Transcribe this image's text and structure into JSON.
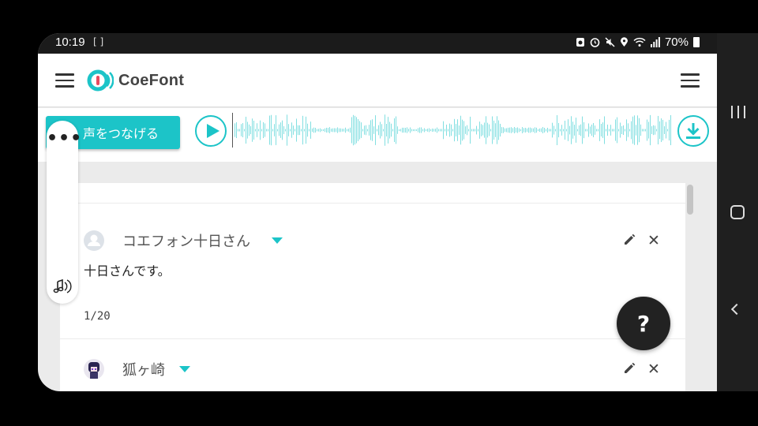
{
  "status_bar": {
    "time": "10:19",
    "bracket": "[ ]",
    "battery": "70%"
  },
  "app": {
    "logo_text": "CoeFont",
    "brand_color": "#1cc4c8"
  },
  "toolbar": {
    "connect_label": "声をつなげる",
    "play_icon": "play-icon",
    "download_icon": "download-icon"
  },
  "side_menu": {
    "more_label": "•••"
  },
  "entries": [
    {
      "speaker": "コエフォン十日さん",
      "text": "十日さんです。",
      "counter": "1/20",
      "avatar": "default-avatar"
    },
    {
      "speaker": "狐ヶ崎",
      "text": "",
      "counter": "",
      "avatar": "character-avatar"
    }
  ],
  "help_fab": {
    "label": "?"
  }
}
